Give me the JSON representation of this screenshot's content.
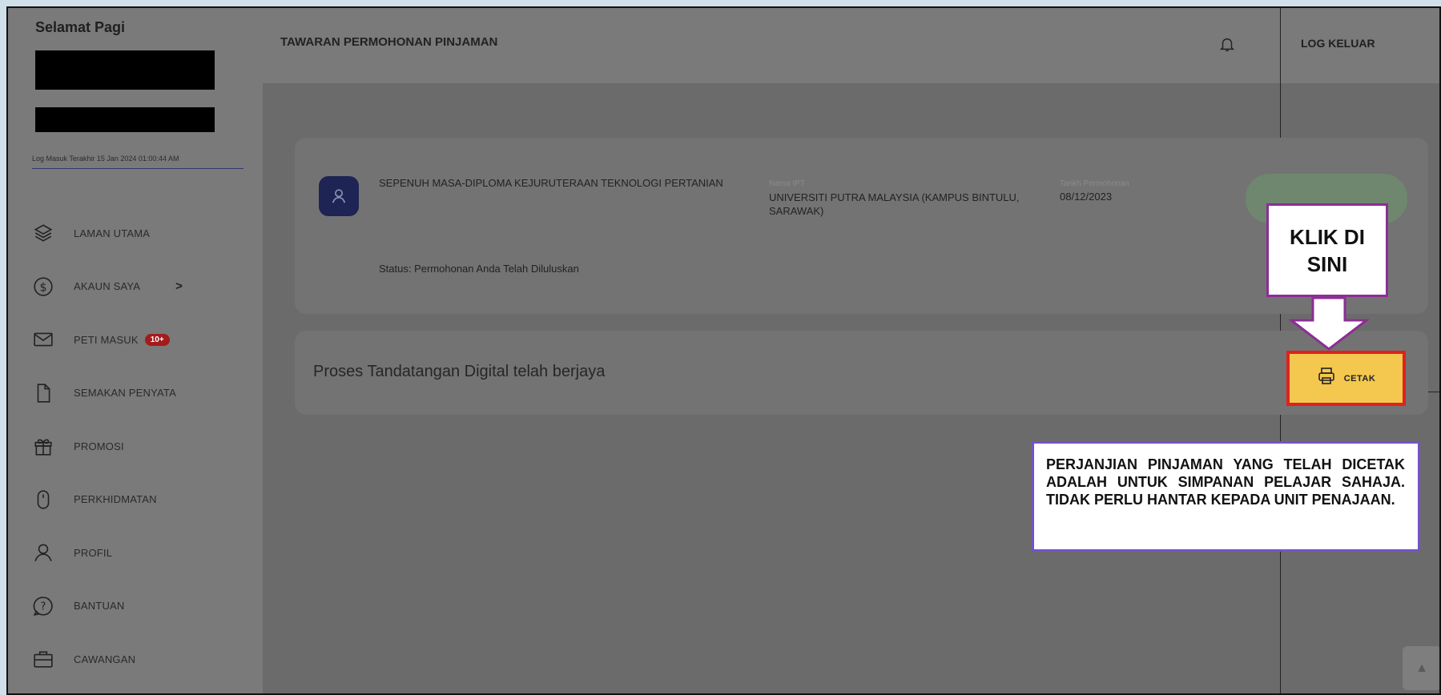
{
  "sidebar": {
    "greeting": "Selamat Pagi",
    "last_login": "Log Masuk Terakhir 15 Jan 2024 01:00:44 AM",
    "items": [
      {
        "label": "LAMAN UTAMA",
        "icon": "layers-icon"
      },
      {
        "label": "AKAUN SAYA",
        "icon": "dollar-icon",
        "chevron": ">"
      },
      {
        "label": "PETI MASUK",
        "icon": "mail-icon",
        "badge": "10+"
      },
      {
        "label": "SEMAKAN PENYATA",
        "icon": "document-icon"
      },
      {
        "label": "PROMOSI",
        "icon": "gift-icon"
      },
      {
        "label": "PERKHIDMATAN",
        "icon": "mouse-icon"
      },
      {
        "label": "PROFIL",
        "icon": "user-icon"
      },
      {
        "label": "BANTUAN",
        "icon": "help-icon"
      },
      {
        "label": "CAWANGAN",
        "icon": "briefcase-icon"
      }
    ]
  },
  "header": {
    "title": "TAWARAN PERMOHONAN PINJAMAN",
    "logout": "LOG KELUAR"
  },
  "application": {
    "course": "SEPENUH MASA-DIPLOMA KEJURUTERAAN TEKNOLOGI PERTANIAN",
    "ipt_label": "Nama IPT",
    "ipt_value": "UNIVERSITI PUTRA MALAYSIA (KAMPUS BINTULU, SARAWAK)",
    "date_label": "Tarikh Permohonan",
    "date_value": "08/12/2023",
    "status": "Status: Permohonan Anda Telah Diluluskan"
  },
  "signature": {
    "message": "Proses Tandatangan Digital telah berjaya",
    "print_label": "CETAK"
  },
  "callouts": {
    "click_here": "KLIK DI SINI",
    "note": "PERJANJIAN PINJAMAN YANG TELAH DICETAK ADALAH UNTUK SIMPANAN PELAJAR SAHAJA. TIDAK PERLU HANTAR KEPADA UNIT PENAJAAN.",
    "border_color": "#8b2f94",
    "highlight_color": "#e0211e"
  }
}
